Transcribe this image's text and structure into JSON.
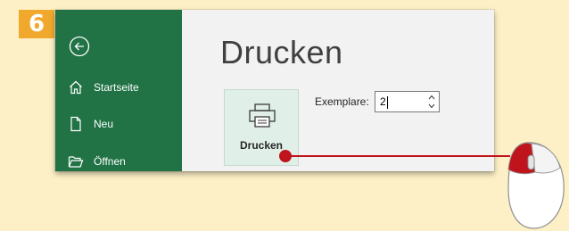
{
  "step": {
    "number": "6"
  },
  "backstage": {
    "nav": [
      {
        "label": "Startseite",
        "icon": "home-icon"
      },
      {
        "label": "Neu",
        "icon": "new-document-icon"
      },
      {
        "label": "Öffnen",
        "icon": "folder-open-icon"
      }
    ],
    "title": "Drucken",
    "print_button_label": "Drucken",
    "copies_label": "Exemplare:",
    "copies_value": "2"
  },
  "colors": {
    "sidebar": "#217346",
    "background": "#fdf0c6",
    "badge": "#f0a92d",
    "pointer": "#c0141c"
  }
}
